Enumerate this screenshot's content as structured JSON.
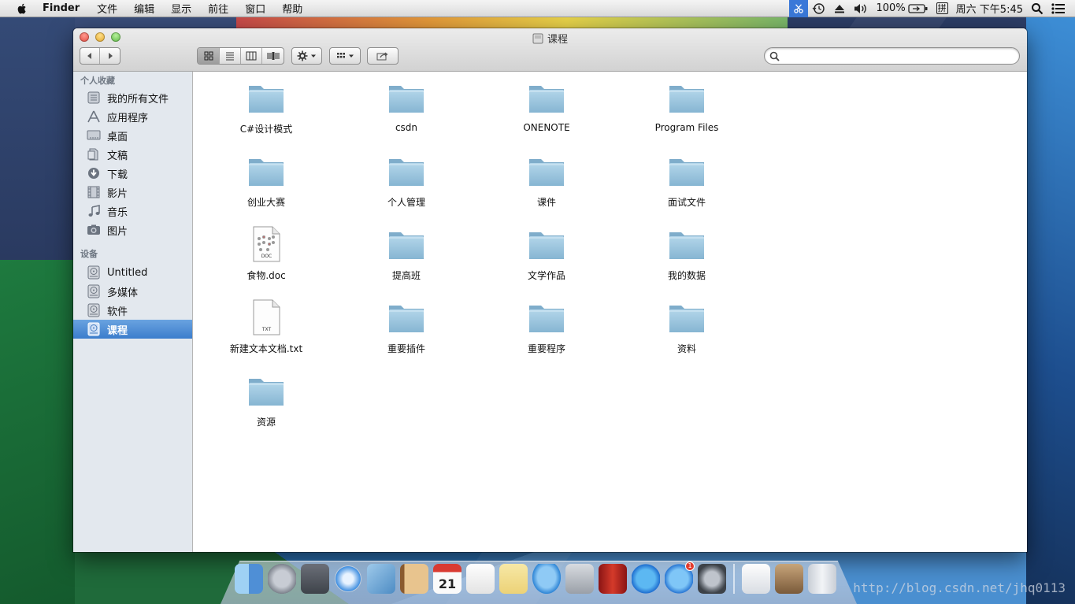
{
  "menubar": {
    "app_name": "Finder",
    "menus": [
      "文件",
      "编辑",
      "显示",
      "前往",
      "窗口",
      "帮助"
    ],
    "battery": "100%",
    "input_method": "拼",
    "clock": "周六 下午5:45"
  },
  "window": {
    "title": "课程",
    "search_placeholder": ""
  },
  "sidebar": {
    "favorites_header": "个人收藏",
    "favorites": [
      {
        "label": "我的所有文件",
        "icon": "all-files-icon"
      },
      {
        "label": "应用程序",
        "icon": "applications-icon"
      },
      {
        "label": "桌面",
        "icon": "desktop-icon"
      },
      {
        "label": "文稿",
        "icon": "documents-icon"
      },
      {
        "label": "下载",
        "icon": "downloads-icon"
      },
      {
        "label": "影片",
        "icon": "movies-icon"
      },
      {
        "label": "音乐",
        "icon": "music-icon"
      },
      {
        "label": "图片",
        "icon": "pictures-icon"
      }
    ],
    "devices_header": "设备",
    "devices": [
      {
        "label": "Untitled",
        "icon": "disk-icon"
      },
      {
        "label": "多媒体",
        "icon": "disk-icon"
      },
      {
        "label": "软件",
        "icon": "disk-icon"
      },
      {
        "label": "课程",
        "icon": "disk-icon",
        "selected": true
      }
    ]
  },
  "files": [
    {
      "name": "C#设计模式",
      "kind": "folder"
    },
    {
      "name": "csdn",
      "kind": "folder"
    },
    {
      "name": "ONENOTE",
      "kind": "folder"
    },
    {
      "name": "Program Files",
      "kind": "folder"
    },
    {
      "name": "创业大赛",
      "kind": "folder"
    },
    {
      "name": "个人管理",
      "kind": "folder"
    },
    {
      "name": "课件",
      "kind": "folder"
    },
    {
      "name": "面试文件",
      "kind": "folder"
    },
    {
      "name": "食物.doc",
      "kind": "doc",
      "badge": "DOC"
    },
    {
      "name": "提高班",
      "kind": "folder"
    },
    {
      "name": "文学作品",
      "kind": "folder"
    },
    {
      "name": "我的数据",
      "kind": "folder"
    },
    {
      "name": "新建文本文档.txt",
      "kind": "txt",
      "badge": "TXT"
    },
    {
      "name": "重要插件",
      "kind": "folder"
    },
    {
      "name": "重要程序",
      "kind": "folder"
    },
    {
      "name": "资料",
      "kind": "folder"
    },
    {
      "name": "资源",
      "kind": "folder"
    }
  ],
  "dock": {
    "calendar_day": "21",
    "appstore_badge": "1",
    "apps": [
      "finder-icon",
      "launchpad-icon",
      "mission-control-icon",
      "safari-icon",
      "mail-icon",
      "contacts-icon",
      "calendar-icon",
      "reminders-icon",
      "notes-icon",
      "messages-icon",
      "facetime-icon",
      "photo-booth-icon",
      "itunes-icon",
      "app-store-icon",
      "system-preferences-icon",
      "documents-stack-icon",
      "photo-stack-icon",
      "trash-icon"
    ]
  },
  "watermark": "http://blog.csdn.net/jhq0113",
  "colors": {
    "selection": "#3b7dcc",
    "folder": "#8fbcd6",
    "sidebar_bg": "#e3e8ee"
  }
}
